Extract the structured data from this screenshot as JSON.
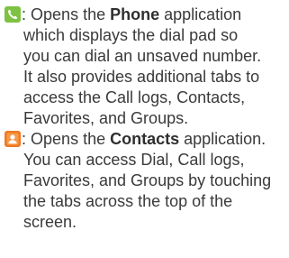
{
  "entries": [
    {
      "icon": "phone-icon",
      "icon_color": "#7dc242",
      "colon": ":",
      "prefix": "Opens the ",
      "app": "Phone",
      "suffix": " application",
      "lines": [
        "which displays the dial pad so",
        "you can dial an unsaved number.",
        "It also provides additional tabs to",
        "access the Call logs, Contacts,",
        "Favorites, and Groups."
      ]
    },
    {
      "icon": "contacts-icon",
      "icon_color": "#f07a22",
      "colon": ":",
      "prefix": "Opens the ",
      "app": "Contacts",
      "suffix": " application.",
      "lines": [
        "You can access Dial, Call logs,",
        "Favorites, and Groups by touching",
        "the tabs across the top of the",
        "screen."
      ]
    }
  ]
}
